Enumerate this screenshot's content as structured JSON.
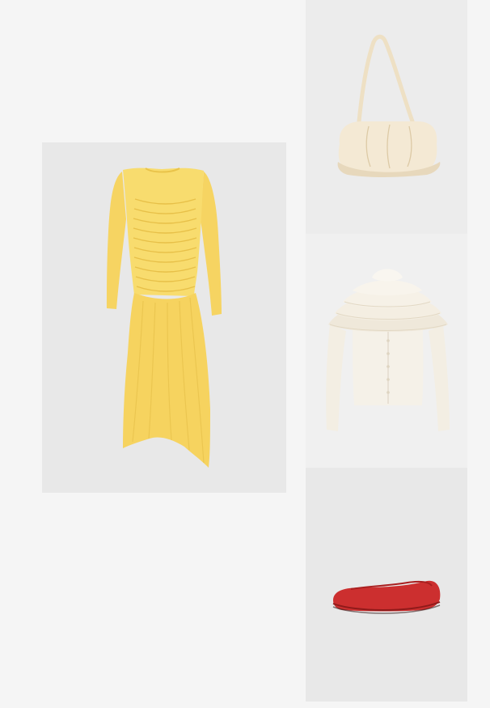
{
  "outfit": {
    "items": [
      {
        "category": "dress",
        "icon": "yellow-ruched-dress-icon",
        "color": "#f7d96b"
      },
      {
        "category": "bag",
        "icon": "cream-handbag-icon",
        "color": "#f4e9d4"
      },
      {
        "category": "top",
        "icon": "cream-ruffle-cardigan-icon",
        "color": "#f3eee3"
      },
      {
        "category": "shoe",
        "icon": "red-ballet-flat-icon",
        "color": "#cc2f2f"
      }
    ]
  }
}
